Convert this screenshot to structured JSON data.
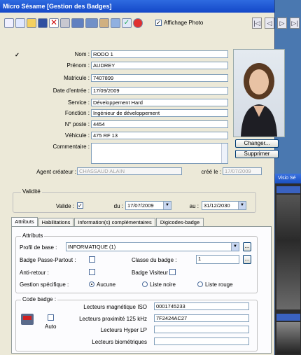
{
  "window": {
    "title": "Micro Sésame [Gestion des Badges]"
  },
  "toolbar": {
    "icons": [
      "new-icon",
      "copy-icon",
      "open-icon",
      "save-icon",
      "delete-icon",
      "print-icon",
      "badge-icon",
      "card-icon",
      "user-icon",
      "export-icon",
      "check-icon",
      "stop-icon"
    ],
    "affichage_photo_label": "Affichage Photo",
    "nav": [
      "|◁",
      "◁",
      "▷",
      "▷|"
    ]
  },
  "identity": {
    "nom_label": "Nom :",
    "nom": "RODO 1",
    "prenom_label": "Prénom :",
    "prenom": "AUDREY",
    "matricule_label": "Matricule :",
    "matricule": "7407899",
    "date_label": "Date d'entrée :",
    "date": "17/09/2009",
    "service_label": "Service :",
    "service": "Développement Hard",
    "fonction_label": "Fonction :",
    "fonction": "Ingénieur de développement",
    "poste_label": "N° poste :",
    "poste": "4454",
    "vehicule_label": "Véhicule :",
    "vehicule": "475 RF 13",
    "commentaire_label": "Commentaire :"
  },
  "photo": {
    "changer": "Changer...",
    "supprimer": "Supprimer"
  },
  "agent": {
    "label": "Agent créateur :",
    "value": "CHASSAUD ALAIN",
    "cree_label": "créé le :",
    "cree_value": "17/07/2009"
  },
  "validite": {
    "title": "Validité",
    "valide_label": "Valide :",
    "du_label": "du :",
    "du_value": "17/07/2009",
    "au_label": "au :",
    "au_value": "31/12/2030"
  },
  "tabs": [
    "Attributs",
    "Habilitations",
    "Information(s) complémentaires",
    "Digicodes-badge"
  ],
  "attributs": {
    "title": "Attributs",
    "profil_label": "Profil de base :",
    "profil_value": "INFORMATIQUE (1)",
    "passe_label": "Badge Passe-Partout :",
    "classe_label": "Classe du badge :",
    "classe_value": "1",
    "antiretour_label": "Anti-retour :",
    "visiteur_label": "Badge Visiteur",
    "gestion_label": "Gestion spécifique :",
    "gestion_options": [
      "Aucune",
      "Liste noire",
      "Liste rouge"
    ]
  },
  "code": {
    "title": "Code badge :",
    "auto_label": "Auto",
    "iso_label": "Lecteurs magnétique ISO",
    "iso_value": "0001745233",
    "prox_label": "Lecteurs proximité 125 kHz",
    "prox_value": "7F2424AC27",
    "hyper_label": "Lecteurs Hyper LP",
    "hyper_value": "",
    "bio_label": "Lecteurs biométriques",
    "bio_value": ""
  },
  "second_window": {
    "title": "Visio Sé"
  }
}
